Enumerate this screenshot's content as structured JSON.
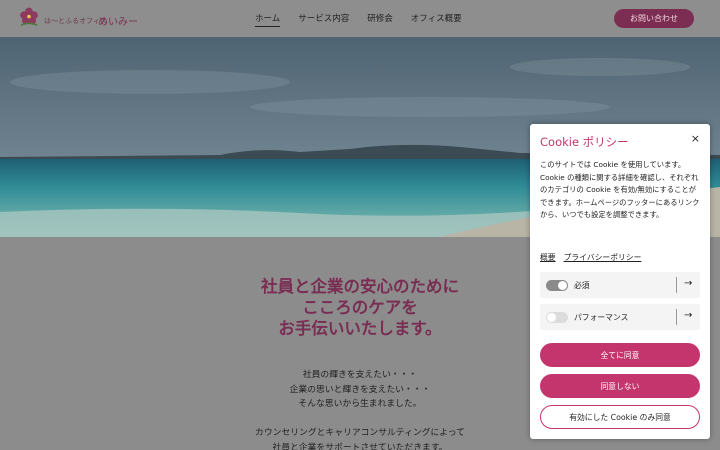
{
  "header": {
    "logo_small": "は〜とふるオフィス",
    "logo_big": "めいみー",
    "nav": [
      "ホーム",
      "サービス内容",
      "研修会",
      "オフィス概要"
    ],
    "contact_label": "お問い合わせ"
  },
  "main": {
    "heading_lines": [
      "社員と企業の安心のために",
      "こころのケアを",
      "お手伝いいたします。"
    ],
    "body_lines": [
      "社員の輝きを支えたい・・・",
      "企業の思いと輝きを支えたい・・・",
      "そんな思いから生まれました。",
      "",
      "カウンセリングとキャリアコンサルティングによって",
      "社員と企業をサポートさせていただきます。"
    ]
  },
  "cookie": {
    "title": "Cookie ポリシー",
    "close": "×",
    "description": "このサイトでは Cookie を使用しています。Cookie の種類に関する詳細を確認し、それぞれのカテゴリの Cookie を有効/無効にすることができます。ホームページのフッターにあるリンクから、いつでも設定を調整できます。",
    "links": [
      "概要",
      "プライバシーポリシー"
    ],
    "categories": [
      {
        "label": "必須",
        "enabled": true
      },
      {
        "label": "パフォーマンス",
        "enabled": false
      }
    ],
    "buttons": {
      "accept_all": "全てに同意",
      "reject": "同意しない",
      "accept_selected": "有効にした Cookie のみ同意"
    }
  },
  "colors": {
    "accent": "#c5356d",
    "brand_dark": "#7a2d52"
  }
}
